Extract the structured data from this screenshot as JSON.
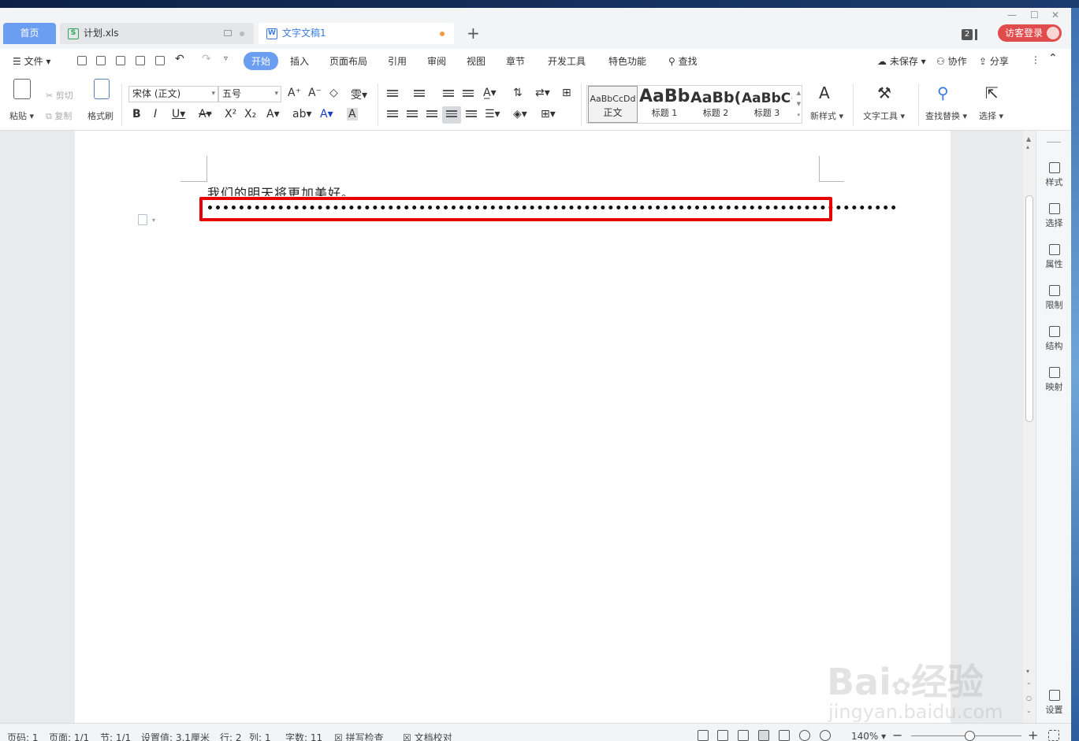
{
  "tabs": {
    "home": "首页",
    "items": [
      {
        "label": "计划.xls",
        "icon": "S"
      },
      {
        "label": "文字文稿1",
        "icon": "W"
      }
    ],
    "counter": "2",
    "login": "访客登录"
  },
  "menu": {
    "file": "文件",
    "items": [
      "开始",
      "插入",
      "页面布局",
      "引用",
      "审阅",
      "视图",
      "章节",
      "开发工具",
      "特色功能"
    ],
    "search": "查找",
    "unsaved": "未保存",
    "collab": "协作",
    "share": "分享"
  },
  "ribbon": {
    "paste": "粘贴",
    "cut": "剪切",
    "copy": "复制",
    "format_painter": "格式刷",
    "font_name": "宋体 (正文)",
    "font_size": "五号",
    "styles": [
      {
        "preview": "AaBbCcDd",
        "label": "正文"
      },
      {
        "preview": "AaBb",
        "label": "标题 1"
      },
      {
        "preview": "AaBb(",
        "label": "标题 2"
      },
      {
        "preview": "AaBbC(",
        "label": "标题 3"
      }
    ],
    "new_style": "新样式",
    "text_tools": "文字工具",
    "find_replace": "查找替换",
    "select": "选择"
  },
  "document": {
    "line1": "我们的明天将更加美好。"
  },
  "right_panel": [
    "样式",
    "选择",
    "属性",
    "限制",
    "结构",
    "映射",
    "设置"
  ],
  "status": {
    "page_code": "页码: 1",
    "pages": "页面: 1/1",
    "section": "节: 1/1",
    "setting": "设置值: 3.1厘米",
    "row": "行: 2",
    "col": "列: 1",
    "word_count": "字数: 11",
    "spell_check": "拼写检查",
    "doc_proof": "文档校对",
    "zoom": "140%"
  },
  "watermark": {
    "brand": "Bai",
    "brand2": "经验",
    "url": "jingyan.baidu.com"
  },
  "colors": {
    "accent": "#6b9df0",
    "highlight": "#e60000",
    "login": "#e04b4b"
  }
}
